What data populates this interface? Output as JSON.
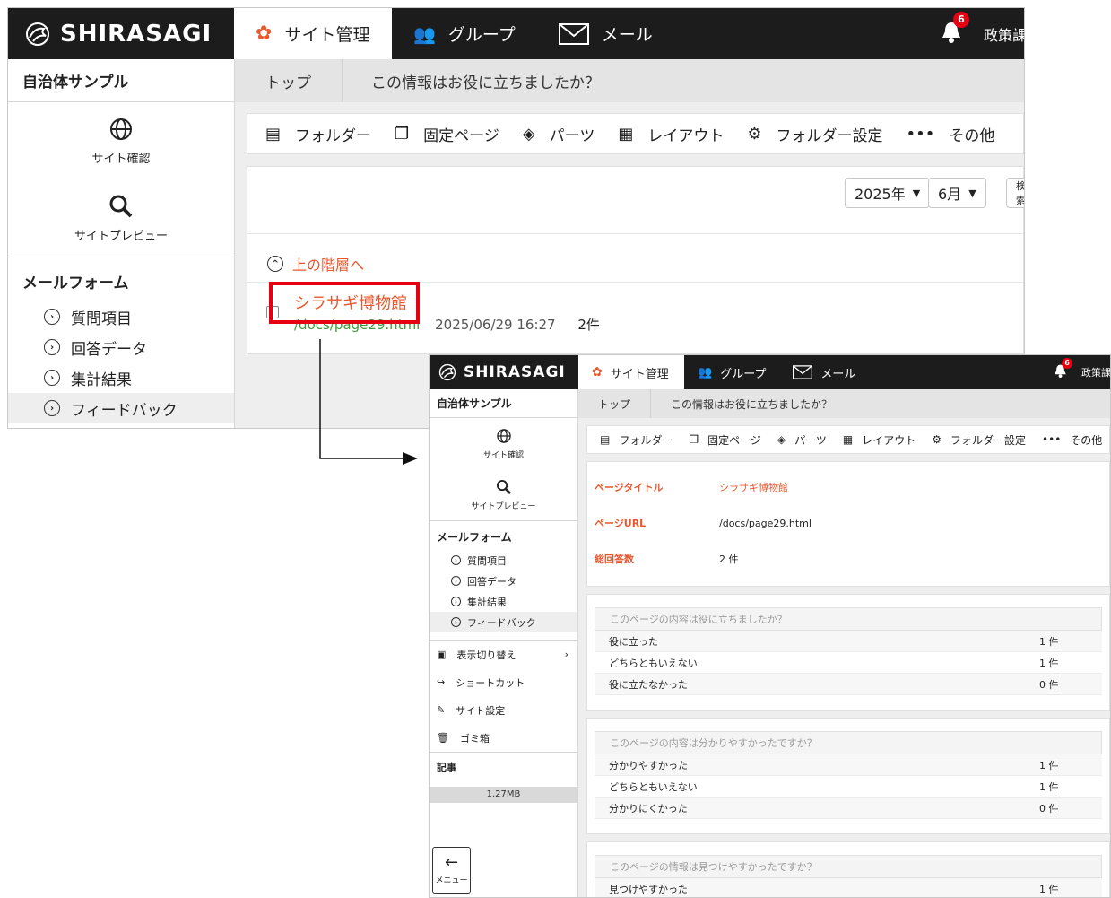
{
  "front": {
    "logo": "SHIRASAGI",
    "nav": {
      "site": "サイト管理",
      "group": "グループ",
      "mail": "メール"
    },
    "notification_count": "6",
    "user": "政策課",
    "site_name": "自治体サンプル",
    "sidebar": {
      "site_check": "サイト確認",
      "site_preview": "サイトプレビュー",
      "section_title": "メールフォーム",
      "items": [
        {
          "label": "質問項目"
        },
        {
          "label": "回答データ"
        },
        {
          "label": "集計結果"
        },
        {
          "label": "フィードバック"
        }
      ]
    },
    "breadcrumb": {
      "top": "トップ",
      "current": "この情報はお役に立ちましたか？"
    },
    "toolbar": {
      "folder": "フォルダー",
      "fixed_page": "固定ページ",
      "parts": "パーツ",
      "layout": "レイアウト",
      "folder_settings": "フォルダー設定",
      "more": "その他"
    },
    "filters": {
      "year": "2025年",
      "month": "6月",
      "search": "検索"
    },
    "up_link": "上の階層へ",
    "row": {
      "title": "シラサギ博物館",
      "url": "/docs/page29.html",
      "date": "2025/06/29 16:27",
      "count": "2件"
    }
  },
  "back": {
    "logo": "SHIRASAGI",
    "nav": {
      "site": "サイト管理",
      "group": "グループ",
      "mail": "メール"
    },
    "notification_count": "6",
    "user": "政策課",
    "site_name": "自治体サンプル",
    "sidebar": {
      "site_check": "サイト確認",
      "site_preview": "サイトプレビュー",
      "section_title": "メールフォーム",
      "items": [
        {
          "label": "質問項目"
        },
        {
          "label": "回答データ"
        },
        {
          "label": "集計結果"
        },
        {
          "label": "フィードバック"
        }
      ],
      "display_toggle": "表示切り替え",
      "shortcut": "ショートカット",
      "site_settings": "サイト設定",
      "trash": "ゴミ箱",
      "article": "記事",
      "usage": "1.27MB",
      "menu": "メニュー"
    },
    "breadcrumb": {
      "top": "トップ",
      "current": "この情報はお役に立ちましたか？"
    },
    "toolbar": {
      "folder": "フォルダー",
      "fixed_page": "固定ページ",
      "parts": "パーツ",
      "layout": "レイアウト",
      "folder_settings": "フォルダー設定",
      "more": "その他"
    },
    "info": {
      "page_title_label": "ページタイトル",
      "page_title_value": "シラサギ博物館",
      "page_url_label": "ページURL",
      "page_url_value": "/docs/page29.html",
      "total_label": "総回答数",
      "total_value": "2 件"
    },
    "questions": [
      {
        "title": "このページの内容は役に立ちましたか？",
        "rows": [
          {
            "label": "役に立った",
            "count": "1 件"
          },
          {
            "label": "どちらともいえない",
            "count": "1 件"
          },
          {
            "label": "役に立たなかった",
            "count": "0 件"
          }
        ]
      },
      {
        "title": "このページの内容は分かりやすかったですか？",
        "rows": [
          {
            "label": "分かりやすかった",
            "count": "1 件"
          },
          {
            "label": "どちらともいえない",
            "count": "1 件"
          },
          {
            "label": "分かりにくかった",
            "count": "0 件"
          }
        ]
      },
      {
        "title": "このページの情報は見つけやすかったですか？",
        "rows": [
          {
            "label": "見つけやすかった",
            "count": "1 件"
          }
        ]
      }
    ]
  },
  "colors": {
    "accent": "#e8582e",
    "header": "#1c1c1c",
    "highlight": "#e60012",
    "url_green": "#3a9a3a"
  }
}
